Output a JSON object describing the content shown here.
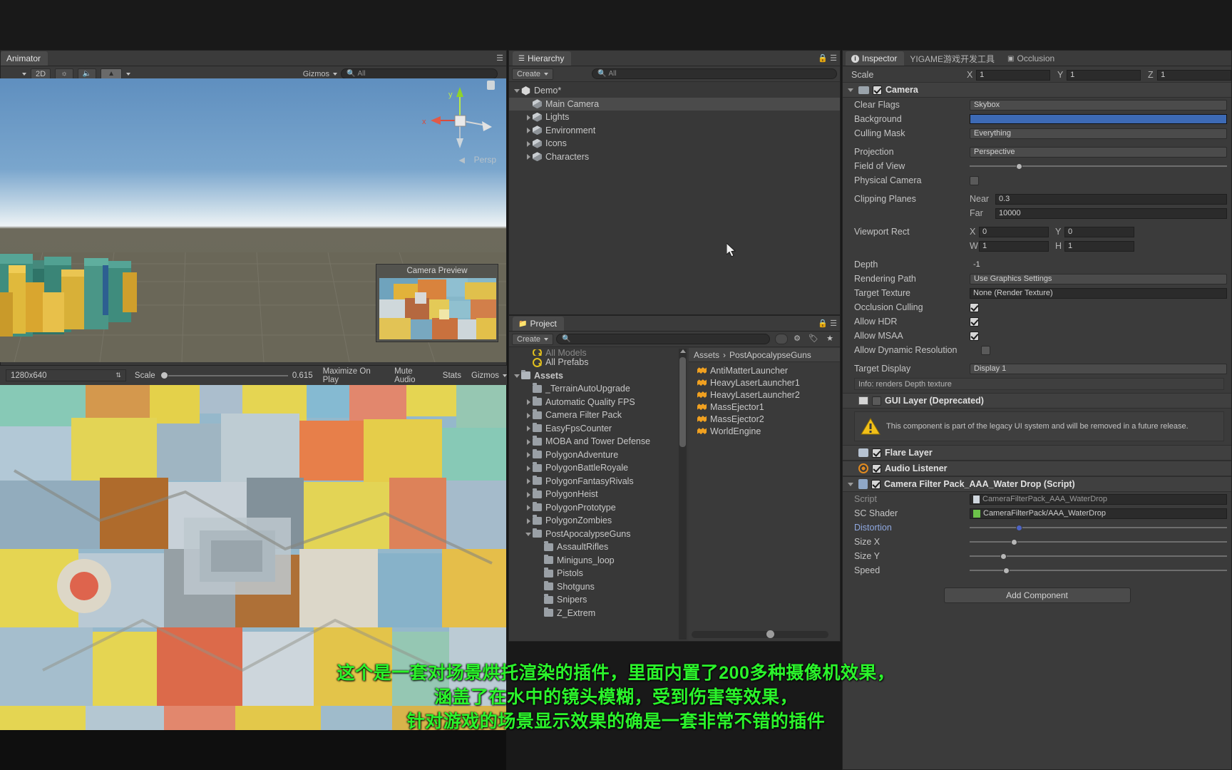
{
  "animator_panel": {
    "tab_label": "Animator",
    "toolbar": {
      "twod": "2D",
      "gizmos": "Gizmos",
      "search_placeholder": "All"
    },
    "persp_label": "Persp",
    "axis_x": "x",
    "axis_y": "y",
    "camera_preview_title": "Camera Preview"
  },
  "game_toolbar": {
    "resolution": "1280x640",
    "scale_label": "Scale",
    "scale_value": "0.615",
    "maximize_on_play": "Maximize On Play",
    "mute_audio": "Mute Audio",
    "stats": "Stats",
    "gizmos": "Gizmos"
  },
  "hierarchy": {
    "tab_label": "Hierarchy",
    "create_label": "Create",
    "search_placeholder": "All",
    "items": [
      {
        "label": "Demo*",
        "depth": 0,
        "icon": "unity-icon",
        "arrow": "down",
        "selected": false
      },
      {
        "label": "Main Camera",
        "depth": 1,
        "icon": "cube-icon",
        "arrow": "none",
        "selected": true
      },
      {
        "label": "Lights",
        "depth": 1,
        "icon": "cube-icon",
        "arrow": "right",
        "selected": false
      },
      {
        "label": "Environment",
        "depth": 1,
        "icon": "cube-icon",
        "arrow": "right",
        "selected": false
      },
      {
        "label": "Icons",
        "depth": 1,
        "icon": "cube-icon",
        "arrow": "right",
        "selected": false
      },
      {
        "label": "Characters",
        "depth": 1,
        "icon": "cube-icon",
        "arrow": "right",
        "selected": false
      }
    ]
  },
  "project": {
    "tab_label": "Project",
    "create_label": "Create",
    "search_placeholder": "",
    "tree": [
      {
        "label": "All Models",
        "depth": 1,
        "icon": "search-icon",
        "arrow": "none",
        "clipped": true
      },
      {
        "label": "All Prefabs",
        "depth": 1,
        "icon": "search-icon",
        "arrow": "none"
      },
      {
        "label": "Assets",
        "depth": 0,
        "icon": "folder-open-icon",
        "arrow": "down",
        "bold": true
      },
      {
        "label": "_TerrainAutoUpgrade",
        "depth": 1,
        "icon": "folder-icon",
        "arrow": "none"
      },
      {
        "label": "Automatic Quality FPS",
        "depth": 1,
        "icon": "folder-icon",
        "arrow": "right"
      },
      {
        "label": "Camera Filter Pack",
        "depth": 1,
        "icon": "folder-icon",
        "arrow": "right"
      },
      {
        "label": "EasyFpsCounter",
        "depth": 1,
        "icon": "folder-icon",
        "arrow": "right"
      },
      {
        "label": "MOBA and Tower Defense",
        "depth": 1,
        "icon": "folder-icon",
        "arrow": "right"
      },
      {
        "label": "PolygonAdventure",
        "depth": 1,
        "icon": "folder-icon",
        "arrow": "right"
      },
      {
        "label": "PolygonBattleRoyale",
        "depth": 1,
        "icon": "folder-icon",
        "arrow": "right"
      },
      {
        "label": "PolygonFantasyRivals",
        "depth": 1,
        "icon": "folder-icon",
        "arrow": "right"
      },
      {
        "label": "PolygonHeist",
        "depth": 1,
        "icon": "folder-icon",
        "arrow": "right"
      },
      {
        "label": "PolygonPrototype",
        "depth": 1,
        "icon": "folder-icon",
        "arrow": "right"
      },
      {
        "label": "PolygonZombies",
        "depth": 1,
        "icon": "folder-icon",
        "arrow": "right"
      },
      {
        "label": "PostApocalypseGuns",
        "depth": 1,
        "icon": "folder-icon",
        "arrow": "down"
      },
      {
        "label": "AssaultRifles",
        "depth": 2,
        "icon": "folder-icon",
        "arrow": "none"
      },
      {
        "label": "Miniguns_loop",
        "depth": 2,
        "icon": "folder-icon",
        "arrow": "none"
      },
      {
        "label": "Pistols",
        "depth": 2,
        "icon": "folder-icon",
        "arrow": "none"
      },
      {
        "label": "Shotguns",
        "depth": 2,
        "icon": "folder-icon",
        "arrow": "none"
      },
      {
        "label": "Snipers",
        "depth": 2,
        "icon": "folder-icon",
        "arrow": "none"
      },
      {
        "label": "Z_Extrem",
        "depth": 2,
        "icon": "folder-icon",
        "arrow": "none"
      }
    ],
    "breadcrumb": [
      "Assets",
      "PostApocalypseGuns"
    ],
    "breadcrumb_sep": "›",
    "assets": [
      {
        "label": "AntiMatterLauncher",
        "icon": "prefab-icon"
      },
      {
        "label": "HeavyLaserLauncher1",
        "icon": "prefab-icon"
      },
      {
        "label": "HeavyLaserLauncher2",
        "icon": "prefab-icon"
      },
      {
        "label": "MassEjector1",
        "icon": "prefab-icon"
      },
      {
        "label": "MassEjector2",
        "icon": "prefab-icon"
      },
      {
        "label": "WorldEngine",
        "icon": "prefab-icon"
      }
    ]
  },
  "inspector": {
    "tabs": [
      {
        "label": "Inspector",
        "active": true,
        "icon": "info-icon"
      },
      {
        "label": "YIGAME游戏开发工具",
        "active": false,
        "icon": "none"
      },
      {
        "label": "Occlusion",
        "active": false,
        "icon": "occlusion-icon"
      }
    ],
    "scale": {
      "label": "Scale",
      "x_label": "X",
      "x": "1",
      "y_label": "Y",
      "y": "1",
      "z_label": "Z",
      "z": "1"
    },
    "camera": {
      "title": "Camera",
      "enabled": true,
      "clear_flags": {
        "label": "Clear Flags",
        "value": "Skybox"
      },
      "background": {
        "label": "Background",
        "color": "#3d6ab5"
      },
      "culling_mask": {
        "label": "Culling Mask",
        "value": "Everything"
      },
      "projection": {
        "label": "Projection",
        "value": "Perspective"
      },
      "field_of_view": {
        "label": "Field of View",
        "fill": 0.2
      },
      "physical_camera": {
        "label": "Physical Camera",
        "checked": false
      },
      "clipping_planes": {
        "label": "Clipping Planes",
        "near_label": "Near",
        "near": "0.3",
        "far_label": "Far",
        "far": "10000"
      },
      "viewport_rect": {
        "label": "Viewport Rect",
        "x_label": "X",
        "x": "0",
        "y_label": "Y",
        "y": "0",
        "w_label": "W",
        "w": "1",
        "h_label": "H",
        "h": "1"
      },
      "depth": {
        "label": "Depth",
        "value": "-1"
      },
      "rendering_path": {
        "label": "Rendering Path",
        "value": "Use Graphics Settings"
      },
      "target_texture": {
        "label": "Target Texture",
        "value": "None (Render Texture)"
      },
      "occlusion_culling": {
        "label": "Occlusion Culling",
        "checked": true
      },
      "allow_hdr": {
        "label": "Allow HDR",
        "checked": true
      },
      "allow_msaa": {
        "label": "Allow MSAA",
        "checked": true
      },
      "allow_dynamic_resolution": {
        "label": "Allow Dynamic Resolution",
        "checked": false
      },
      "target_display": {
        "label": "Target Display",
        "value": "Display 1"
      },
      "info": "Info: renders Depth texture"
    },
    "gui_layer": {
      "title": "GUI Layer (Deprecated)",
      "enabled": false,
      "warning": "This component is part of the legacy UI system and will be removed in a future release."
    },
    "flare_layer": {
      "title": "Flare Layer",
      "enabled": true
    },
    "audio_listener": {
      "title": "Audio Listener",
      "enabled": true
    },
    "camera_filter_pack": {
      "title": "Camera Filter Pack_AAA_Water Drop (Script)",
      "enabled": true,
      "script": {
        "label": "Script",
        "value": "CameraFilterPack_AAA_WaterDrop"
      },
      "sc_shader": {
        "label": "SC Shader",
        "value": "CameraFilterPack/AAA_WaterDrop"
      },
      "distortion": {
        "label": "Distortion",
        "fill": 0.19
      },
      "size_x": {
        "label": "Size X",
        "fill": 0.17
      },
      "size_y": {
        "label": "Size Y",
        "fill": 0.13
      },
      "speed": {
        "label": "Speed",
        "fill": 0.14
      }
    },
    "add_component": "Add Component"
  },
  "subtitles": [
    "这个是一套对场景烘托渲染的插件，里面内置了200多种摄像机效果，",
    "涵盖了在水中的镜头模糊，受到伤害等效果，",
    "针对游戏的场景显示效果的确是一套非常不错的插件"
  ],
  "colors": {
    "accent": "#3d6ab5",
    "subtitle": "#2bf32b",
    "prefab": "#f0a020",
    "panel_bg": "#383838"
  }
}
